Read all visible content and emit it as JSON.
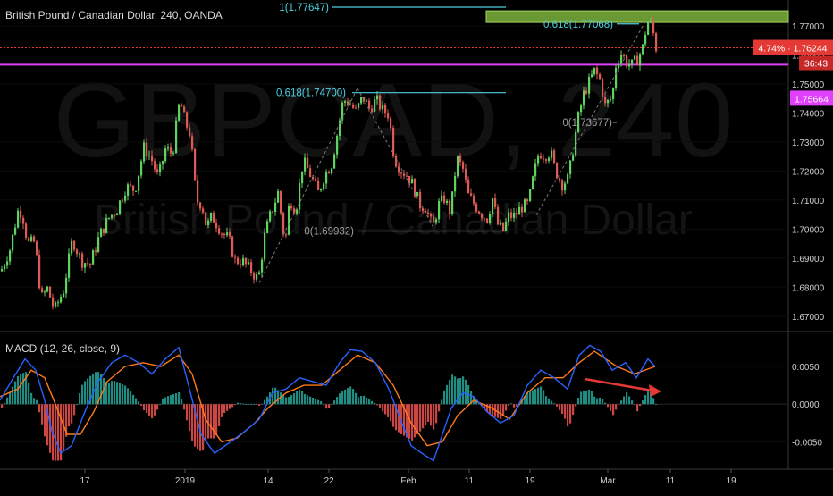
{
  "header": {
    "symbol_title": "British Pound / Canadian Dollar, 240, OANDA",
    "watermark_symbol": "GBPCAD, 240",
    "watermark_name": "British Pound / Canadian Dollar",
    "macd_label": "MACD (12, 26, close, 9)"
  },
  "colors": {
    "background": "#000000",
    "up_candle": "#5fd35f",
    "down_candle": "#e05a55",
    "fib_line": "#4dd0e1",
    "resistance_line": "#e040fb",
    "price_line": "#e53935",
    "zone_fill": "#7cb33c",
    "macd_line": "#2962ff",
    "signal_line": "#ff7a1a",
    "hist_pos": "#26a69a",
    "hist_neg": "#ef5350",
    "arrow": "#e53935"
  },
  "chart_data": [
    {
      "type": "candlestick",
      "title": "British Pound / Canadian Dollar, 240, OANDA",
      "x_ticks": [
        "17",
        "2019",
        "14",
        "22",
        "Feb",
        "11",
        "19",
        "Mar",
        "11",
        "19"
      ],
      "ylim": [
        1.665,
        1.778
      ],
      "y_ticks": [
        1.67,
        1.68,
        1.69,
        1.7,
        1.71,
        1.72,
        1.73,
        1.74,
        1.75,
        1.76,
        1.77
      ],
      "y_tick_labels": [
        "1.67000",
        "1.68000",
        "1.69000",
        "1.70000",
        "1.71000",
        "1.72000",
        "1.73000",
        "1.74000",
        "1.75000",
        "1.76000",
        "1.77000"
      ],
      "last_price": {
        "value": 1.76244,
        "label": "1.76244",
        "change": "4.74%",
        "countdown": "36:43"
      },
      "resistance_level": {
        "value": 1.75664,
        "label": "1.75664"
      },
      "supply_zone": {
        "from": 1.7712,
        "to": 1.7752
      },
      "fib_labels": [
        {
          "text": "1(1.77647)",
          "value": 1.77647
        },
        {
          "text": "0.618(1.77068)",
          "value": 1.77068
        },
        {
          "text": "0.618(1.74700)",
          "value": 1.747
        },
        {
          "text": "0(1.73677)",
          "value": 1.73677
        },
        {
          "text": "0(1.69932)",
          "value": 1.69932
        }
      ],
      "price_path": [
        [
          0,
          1.6855
        ],
        [
          10,
          1.693
        ],
        [
          20,
          1.7075
        ],
        [
          25,
          1.7035
        ],
        [
          30,
          1.695
        ],
        [
          38,
          1.6955
        ],
        [
          45,
          1.676
        ],
        [
          52,
          1.6795
        ],
        [
          60,
          1.672
        ],
        [
          70,
          1.679
        ],
        [
          80,
          1.6965
        ],
        [
          90,
          1.689
        ],
        [
          100,
          1.688
        ],
        [
          110,
          1.6975
        ],
        [
          120,
          1.7035
        ],
        [
          130,
          1.707
        ],
        [
          140,
          1.7145
        ],
        [
          150,
          1.7135
        ],
        [
          160,
          1.728
        ],
        [
          168,
          1.7245
        ],
        [
          176,
          1.7175
        ],
        [
          184,
          1.7275
        ],
        [
          192,
          1.726
        ],
        [
          200,
          1.7445
        ],
        [
          206,
          1.737
        ],
        [
          212,
          1.7325
        ],
        [
          217,
          1.7155
        ],
        [
          220,
          1.7095
        ],
        [
          225,
          1.7085
        ],
        [
          230,
          1.7005
        ],
        [
          236,
          1.7045
        ],
        [
          242,
          1.7015
        ],
        [
          248,
          1.6985
        ],
        [
          255,
          1.6965
        ],
        [
          262,
          1.689
        ],
        [
          270,
          1.689
        ],
        [
          280,
          1.6855
        ],
        [
          288,
          1.6825
        ],
        [
          295,
          1.6975
        ],
        [
          300,
          1.7035
        ],
        [
          310,
          1.7125
        ],
        [
          318,
          1.6945
        ],
        [
          323,
          1.7105
        ],
        [
          330,
          1.7065
        ],
        [
          338,
          1.7235
        ],
        [
          345,
          1.7195
        ],
        [
          355,
          1.7125
        ],
        [
          362,
          1.7185
        ],
        [
          370,
          1.7225
        ],
        [
          376,
          1.7325
        ],
        [
          383,
          1.7445
        ],
        [
          390,
          1.7435
        ],
        [
          397,
          1.7405
        ],
        [
          405,
          1.7455
        ],
        [
          412,
          1.7415
        ],
        [
          420,
          1.7445
        ],
        [
          428,
          1.7405
        ],
        [
          434,
          1.7395
        ],
        [
          440,
          1.7245
        ],
        [
          447,
          1.7205
        ],
        [
          455,
          1.7185
        ],
        [
          462,
          1.7145
        ],
        [
          468,
          1.7085
        ],
        [
          475,
          1.7075
        ],
        [
          483,
          1.7005
        ],
        [
          490,
          1.7085
        ],
        [
          496,
          1.7105
        ],
        [
          503,
          1.7055
        ],
        [
          510,
          1.7245
        ],
        [
          517,
          1.7205
        ],
        [
          523,
          1.7115
        ],
        [
          530,
          1.7085
        ],
        [
          537,
          1.7055
        ],
        [
          544,
          1.7035
        ],
        [
          550,
          1.7105
        ],
        [
          556,
          1.7015
        ],
        [
          562,
          1.6995
        ],
        [
          568,
          1.7045
        ],
        [
          575,
          1.7045
        ],
        [
          582,
          1.7075
        ],
        [
          590,
          1.7085
        ],
        [
          596,
          1.7185
        ],
        [
          602,
          1.7265
        ],
        [
          608,
          1.7255
        ],
        [
          615,
          1.7265
        ],
        [
          620,
          1.7205
        ],
        [
          628,
          1.7155
        ],
        [
          635,
          1.7175
        ],
        [
          640,
          1.7275
        ],
        [
          646,
          1.7385
        ],
        [
          652,
          1.7465
        ],
        [
          658,
          1.7505
        ],
        [
          664,
          1.7545
        ],
        [
          670,
          1.7515
        ],
        [
          676,
          1.7425
        ],
        [
          684,
          1.7455
        ],
        [
          688,
          1.7565
        ],
        [
          694,
          1.7605
        ],
        [
          700,
          1.7575
        ],
        [
          706,
          1.7565
        ],
        [
          712,
          1.7585
        ],
        [
          718,
          1.7625
        ],
        [
          723,
          1.7715
        ],
        [
          728,
          1.7705
        ],
        [
          733,
          1.7625
        ]
      ]
    },
    {
      "type": "bar",
      "title": "MACD (12, 26, close, 9)",
      "ylim": [
        -0.0085,
        0.0095
      ],
      "y_ticks": [
        0.005,
        0.0,
        -0.005
      ],
      "y_tick_labels": [
        "0.0050",
        "0.0000",
        "-0.0050"
      ],
      "series": [
        {
          "name": "MACD",
          "values": [
            [
              0,
              0.0005
            ],
            [
              15,
              0.0035
            ],
            [
              28,
              0.006
            ],
            [
              40,
              0.0045
            ],
            [
              50,
              0.0005
            ],
            [
              58,
              -0.0035
            ],
            [
              68,
              -0.0065
            ],
            [
              80,
              -0.0055
            ],
            [
              95,
              -0.001
            ],
            [
              110,
              0.003
            ],
            [
              125,
              0.0055
            ],
            [
              140,
              0.0065
            ],
            [
              155,
              0.0055
            ],
            [
              170,
              0.004
            ],
            [
              185,
              0.006
            ],
            [
              200,
              0.0075
            ],
            [
              212,
              0.002
            ],
            [
              225,
              -0.004
            ],
            [
              240,
              -0.0065
            ],
            [
              258,
              -0.005
            ],
            [
              275,
              -0.0035
            ],
            [
              290,
              -0.002
            ],
            [
              305,
              0.0015
            ],
            [
              320,
              0.002
            ],
            [
              335,
              0.0035
            ],
            [
              350,
              0.003
            ],
            [
              365,
              0.0025
            ],
            [
              380,
              0.0055
            ],
            [
              392,
              0.0072
            ],
            [
              405,
              0.007
            ],
            [
              420,
              0.0055
            ],
            [
              435,
              0.002
            ],
            [
              448,
              -0.002
            ],
            [
              460,
              -0.0055
            ],
            [
              472,
              -0.0065
            ],
            [
              485,
              -0.0075
            ],
            [
              495,
              -0.004
            ],
            [
              505,
              -0.0005
            ],
            [
              518,
              0.0015
            ],
            [
              530,
              0.001
            ],
            [
              545,
              -0.001
            ],
            [
              560,
              -0.0025
            ],
            [
              575,
              -0.0015
            ],
            [
              590,
              0.0025
            ],
            [
              605,
              0.0045
            ],
            [
              620,
              0.0035
            ],
            [
              635,
              0.002
            ],
            [
              648,
              0.0065
            ],
            [
              660,
              0.0078
            ],
            [
              672,
              0.007
            ],
            [
              685,
              0.0045
            ],
            [
              700,
              0.0055
            ],
            [
              712,
              0.0035
            ],
            [
              725,
              0.006
            ],
            [
              733,
              0.005
            ]
          ]
        },
        {
          "name": "Signal",
          "values": [
            [
              0,
              0.001
            ],
            [
              20,
              0.002
            ],
            [
              35,
              0.0045
            ],
            [
              50,
              0.0035
            ],
            [
              62,
              0.0
            ],
            [
              75,
              -0.004
            ],
            [
              90,
              -0.004
            ],
            [
              105,
              -0.001
            ],
            [
              120,
              0.003
            ],
            [
              140,
              0.005
            ],
            [
              160,
              0.0055
            ],
            [
              180,
              0.005
            ],
            [
              200,
              0.0065
            ],
            [
              215,
              0.004
            ],
            [
              230,
              -0.002
            ],
            [
              248,
              -0.005
            ],
            [
              265,
              -0.0045
            ],
            [
              285,
              -0.0025
            ],
            [
              300,
              -0.0005
            ],
            [
              320,
              0.0015
            ],
            [
              340,
              0.0025
            ],
            [
              360,
              0.0025
            ],
            [
              380,
              0.0045
            ],
            [
              400,
              0.0065
            ],
            [
              420,
              0.0055
            ],
            [
              440,
              0.0025
            ],
            [
              460,
              -0.0025
            ],
            [
              478,
              -0.0055
            ],
            [
              495,
              -0.005
            ],
            [
              512,
              -0.0015
            ],
            [
              530,
              0.0005
            ],
            [
              550,
              -0.0005
            ],
            [
              570,
              -0.002
            ],
            [
              590,
              0.0015
            ],
            [
              610,
              0.0035
            ],
            [
              630,
              0.0035
            ],
            [
              648,
              0.0055
            ],
            [
              665,
              0.007
            ],
            [
              690,
              0.005
            ],
            [
              710,
              0.004
            ],
            [
              733,
              0.005
            ]
          ]
        }
      ]
    }
  ]
}
